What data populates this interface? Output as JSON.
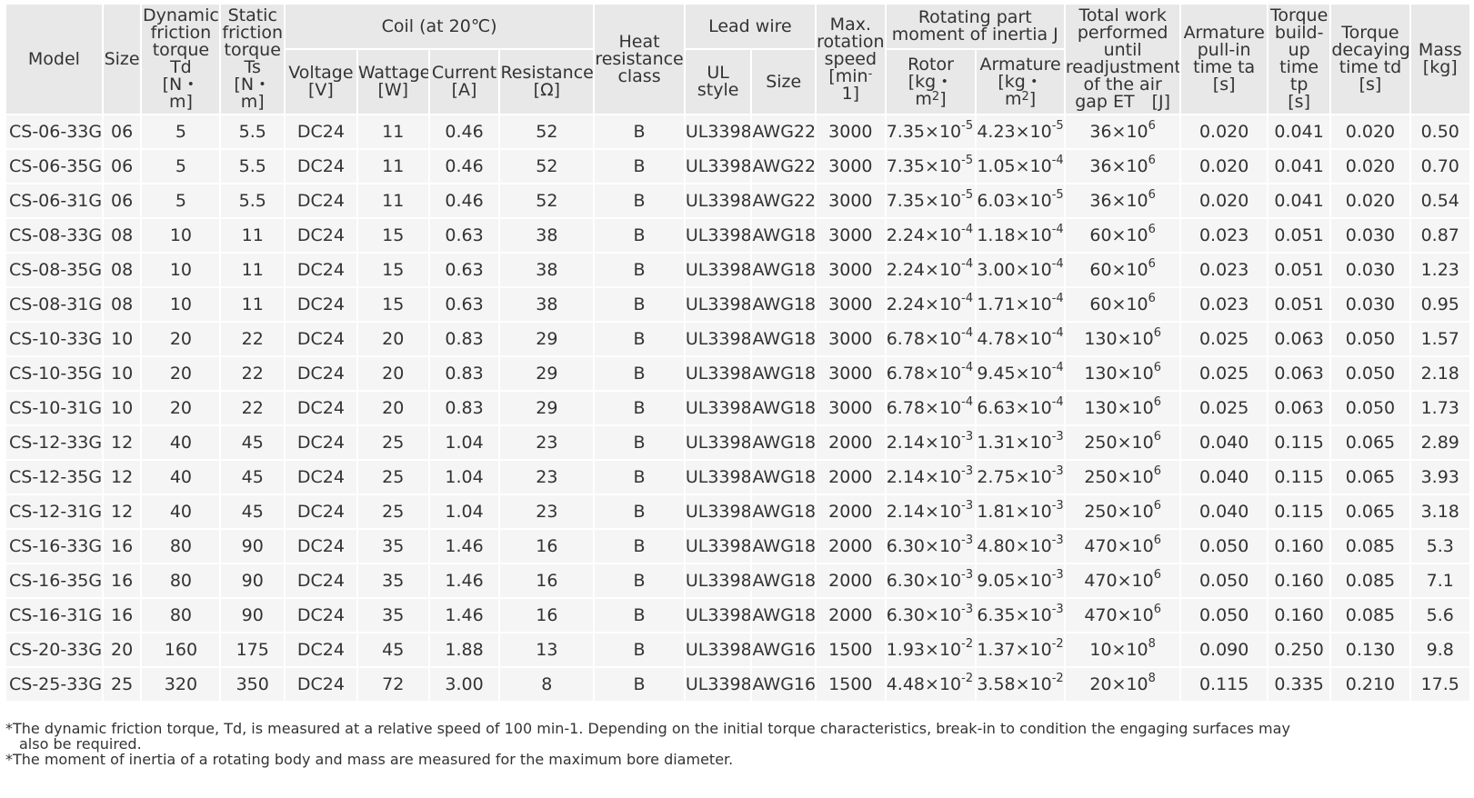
{
  "headers": {
    "model": "Model",
    "size": "Size",
    "dynamic": [
      "Dynamic",
      "friction",
      "torque",
      "Td",
      "[N・",
      "m]"
    ],
    "static": [
      "Static",
      "friction",
      "torque",
      "Ts",
      "[N・",
      "m]"
    ],
    "coil": "Coil (at 20℃)",
    "voltage": [
      "Voltage",
      "[V]"
    ],
    "wattage": [
      "Wattage",
      "[W]"
    ],
    "current": [
      "Current",
      "[A]"
    ],
    "resistance": [
      "Resistance",
      "[Ω]"
    ],
    "heat": [
      "Heat",
      "resistance",
      "class"
    ],
    "lead_wire": "Lead wire",
    "ul_style": [
      "UL",
      "style"
    ],
    "lead_size": "Size",
    "max_speed": [
      "Max.",
      "rotation",
      "speed",
      "[min",
      "-",
      "1]"
    ],
    "inertia": [
      "Rotating part",
      "moment of inertia J"
    ],
    "rotor": [
      "Rotor",
      "[kg・",
      "m",
      "2",
      "]"
    ],
    "armature": [
      "Armature",
      "[kg・",
      "m",
      "2",
      "]"
    ],
    "total_work": [
      "Total work",
      "performed",
      "until",
      "readjustment",
      "of the air",
      "gap ET　[J]"
    ],
    "pullin": [
      "Armature",
      "pull-in",
      "time ta",
      "[s]"
    ],
    "buildup": [
      "Torque",
      "build-",
      "up",
      "time",
      "tp",
      "[s]"
    ],
    "decay": [
      "Torque",
      "decaying",
      "time td",
      "[s]"
    ],
    "mass": [
      "Mass",
      "[kg]"
    ]
  },
  "rows": [
    {
      "model": "CS-06-33G",
      "size": "06",
      "td": "5",
      "ts": "5.5",
      "volt": "DC24",
      "watt": "11",
      "current": "0.46",
      "res": "52",
      "heat": "B",
      "ul": "UL3398",
      "wire": "AWG22",
      "speed": "3000",
      "rotor_m": "7.35×10",
      "rotor_e": "-5",
      "arm_m": "4.23×10",
      "arm_e": "-5",
      "work_m": "36×10",
      "work_e": "6",
      "ta": "0.020",
      "tp": "0.041",
      "tdd": "0.020",
      "mass": "0.50"
    },
    {
      "model": "CS-06-35G",
      "size": "06",
      "td": "5",
      "ts": "5.5",
      "volt": "DC24",
      "watt": "11",
      "current": "0.46",
      "res": "52",
      "heat": "B",
      "ul": "UL3398",
      "wire": "AWG22",
      "speed": "3000",
      "rotor_m": "7.35×10",
      "rotor_e": "-5",
      "arm_m": "1.05×10",
      "arm_e": "-4",
      "work_m": "36×10",
      "work_e": "6",
      "ta": "0.020",
      "tp": "0.041",
      "tdd": "0.020",
      "mass": "0.70"
    },
    {
      "model": "CS-06-31G",
      "size": "06",
      "td": "5",
      "ts": "5.5",
      "volt": "DC24",
      "watt": "11",
      "current": "0.46",
      "res": "52",
      "heat": "B",
      "ul": "UL3398",
      "wire": "AWG22",
      "speed": "3000",
      "rotor_m": "7.35×10",
      "rotor_e": "-5",
      "arm_m": "6.03×10",
      "arm_e": "-5",
      "work_m": "36×10",
      "work_e": "6",
      "ta": "0.020",
      "tp": "0.041",
      "tdd": "0.020",
      "mass": "0.54"
    },
    {
      "model": "CS-08-33G",
      "size": "08",
      "td": "10",
      "ts": "11",
      "volt": "DC24",
      "watt": "15",
      "current": "0.63",
      "res": "38",
      "heat": "B",
      "ul": "UL3398",
      "wire": "AWG18",
      "speed": "3000",
      "rotor_m": "2.24×10",
      "rotor_e": "-4",
      "arm_m": "1.18×10",
      "arm_e": "-4",
      "work_m": "60×10",
      "work_e": "6",
      "ta": "0.023",
      "tp": "0.051",
      "tdd": "0.030",
      "mass": "0.87"
    },
    {
      "model": "CS-08-35G",
      "size": "08",
      "td": "10",
      "ts": "11",
      "volt": "DC24",
      "watt": "15",
      "current": "0.63",
      "res": "38",
      "heat": "B",
      "ul": "UL3398",
      "wire": "AWG18",
      "speed": "3000",
      "rotor_m": "2.24×10",
      "rotor_e": "-4",
      "arm_m": "3.00×10",
      "arm_e": "-4",
      "work_m": "60×10",
      "work_e": "6",
      "ta": "0.023",
      "tp": "0.051",
      "tdd": "0.030",
      "mass": "1.23"
    },
    {
      "model": "CS-08-31G",
      "size": "08",
      "td": "10",
      "ts": "11",
      "volt": "DC24",
      "watt": "15",
      "current": "0.63",
      "res": "38",
      "heat": "B",
      "ul": "UL3398",
      "wire": "AWG18",
      "speed": "3000",
      "rotor_m": "2.24×10",
      "rotor_e": "-4",
      "arm_m": "1.71×10",
      "arm_e": "-4",
      "work_m": "60×10",
      "work_e": "6",
      "ta": "0.023",
      "tp": "0.051",
      "tdd": "0.030",
      "mass": "0.95"
    },
    {
      "model": "CS-10-33G",
      "size": "10",
      "td": "20",
      "ts": "22",
      "volt": "DC24",
      "watt": "20",
      "current": "0.83",
      "res": "29",
      "heat": "B",
      "ul": "UL3398",
      "wire": "AWG18",
      "speed": "3000",
      "rotor_m": "6.78×10",
      "rotor_e": "-4",
      "arm_m": "4.78×10",
      "arm_e": "-4",
      "work_m": "130×10",
      "work_e": "6",
      "ta": "0.025",
      "tp": "0.063",
      "tdd": "0.050",
      "mass": "1.57"
    },
    {
      "model": "CS-10-35G",
      "size": "10",
      "td": "20",
      "ts": "22",
      "volt": "DC24",
      "watt": "20",
      "current": "0.83",
      "res": "29",
      "heat": "B",
      "ul": "UL3398",
      "wire": "AWG18",
      "speed": "3000",
      "rotor_m": "6.78×10",
      "rotor_e": "-4",
      "arm_m": "9.45×10",
      "arm_e": "-4",
      "work_m": "130×10",
      "work_e": "6",
      "ta": "0.025",
      "tp": "0.063",
      "tdd": "0.050",
      "mass": "2.18"
    },
    {
      "model": "CS-10-31G",
      "size": "10",
      "td": "20",
      "ts": "22",
      "volt": "DC24",
      "watt": "20",
      "current": "0.83",
      "res": "29",
      "heat": "B",
      "ul": "UL3398",
      "wire": "AWG18",
      "speed": "3000",
      "rotor_m": "6.78×10",
      "rotor_e": "-4",
      "arm_m": "6.63×10",
      "arm_e": "-4",
      "work_m": "130×10",
      "work_e": "6",
      "ta": "0.025",
      "tp": "0.063",
      "tdd": "0.050",
      "mass": "1.73"
    },
    {
      "model": "CS-12-33G",
      "size": "12",
      "td": "40",
      "ts": "45",
      "volt": "DC24",
      "watt": "25",
      "current": "1.04",
      "res": "23",
      "heat": "B",
      "ul": "UL3398",
      "wire": "AWG18",
      "speed": "2000",
      "rotor_m": "2.14×10",
      "rotor_e": "-3",
      "arm_m": "1.31×10",
      "arm_e": "-3",
      "work_m": "250×10",
      "work_e": "6",
      "ta": "0.040",
      "tp": "0.115",
      "tdd": "0.065",
      "mass": "2.89"
    },
    {
      "model": "CS-12-35G",
      "size": "12",
      "td": "40",
      "ts": "45",
      "volt": "DC24",
      "watt": "25",
      "current": "1.04",
      "res": "23",
      "heat": "B",
      "ul": "UL3398",
      "wire": "AWG18",
      "speed": "2000",
      "rotor_m": "2.14×10",
      "rotor_e": "-3",
      "arm_m": "2.75×10",
      "arm_e": "-3",
      "work_m": "250×10",
      "work_e": "6",
      "ta": "0.040",
      "tp": "0.115",
      "tdd": "0.065",
      "mass": "3.93"
    },
    {
      "model": "CS-12-31G",
      "size": "12",
      "td": "40",
      "ts": "45",
      "volt": "DC24",
      "watt": "25",
      "current": "1.04",
      "res": "23",
      "heat": "B",
      "ul": "UL3398",
      "wire": "AWG18",
      "speed": "2000",
      "rotor_m": "2.14×10",
      "rotor_e": "-3",
      "arm_m": "1.81×10",
      "arm_e": "-3",
      "work_m": "250×10",
      "work_e": "6",
      "ta": "0.040",
      "tp": "0.115",
      "tdd": "0.065",
      "mass": "3.18"
    },
    {
      "model": "CS-16-33G",
      "size": "16",
      "td": "80",
      "ts": "90",
      "volt": "DC24",
      "watt": "35",
      "current": "1.46",
      "res": "16",
      "heat": "B",
      "ul": "UL3398",
      "wire": "AWG18",
      "speed": "2000",
      "rotor_m": "6.30×10",
      "rotor_e": "-3",
      "arm_m": "4.80×10",
      "arm_e": "-3",
      "work_m": "470×10",
      "work_e": "6",
      "ta": "0.050",
      "tp": "0.160",
      "tdd": "0.085",
      "mass": "5.3"
    },
    {
      "model": "CS-16-35G",
      "size": "16",
      "td": "80",
      "ts": "90",
      "volt": "DC24",
      "watt": "35",
      "current": "1.46",
      "res": "16",
      "heat": "B",
      "ul": "UL3398",
      "wire": "AWG18",
      "speed": "2000",
      "rotor_m": "6.30×10",
      "rotor_e": "-3",
      "arm_m": "9.05×10",
      "arm_e": "-3",
      "work_m": "470×10",
      "work_e": "6",
      "ta": "0.050",
      "tp": "0.160",
      "tdd": "0.085",
      "mass": "7.1"
    },
    {
      "model": "CS-16-31G",
      "size": "16",
      "td": "80",
      "ts": "90",
      "volt": "DC24",
      "watt": "35",
      "current": "1.46",
      "res": "16",
      "heat": "B",
      "ul": "UL3398",
      "wire": "AWG18",
      "speed": "2000",
      "rotor_m": "6.30×10",
      "rotor_e": "-3",
      "arm_m": "6.35×10",
      "arm_e": "-3",
      "work_m": "470×10",
      "work_e": "6",
      "ta": "0.050",
      "tp": "0.160",
      "tdd": "0.085",
      "mass": "5.6"
    },
    {
      "model": "CS-20-33G",
      "size": "20",
      "td": "160",
      "ts": "175",
      "volt": "DC24",
      "watt": "45",
      "current": "1.88",
      "res": "13",
      "heat": "B",
      "ul": "UL3398",
      "wire": "AWG16",
      "speed": "1500",
      "rotor_m": "1.93×10",
      "rotor_e": "-2",
      "arm_m": "1.37×10",
      "arm_e": "-2",
      "work_m": "10×10",
      "work_e": "8",
      "ta": "0.090",
      "tp": "0.250",
      "tdd": "0.130",
      "mass": "9.8"
    },
    {
      "model": "CS-25-33G",
      "size": "25",
      "td": "320",
      "ts": "350",
      "volt": "DC24",
      "watt": "72",
      "current": "3.00",
      "res": "8",
      "heat": "B",
      "ul": "UL3398",
      "wire": "AWG16",
      "speed": "1500",
      "rotor_m": "4.48×10",
      "rotor_e": "-2",
      "arm_m": "3.58×10",
      "arm_e": "-2",
      "work_m": "20×10",
      "work_e": "8",
      "ta": "0.115",
      "tp": "0.335",
      "tdd": "0.210",
      "mass": "17.5"
    }
  ],
  "notes": {
    "note1_line1": "*The dynamic friction torque, Td, is measured at a relative speed of 100 min-1. Depending on the initial torque characteristics, break-in to condition the engaging surfaces may",
    "note1_line2": "also be required.",
    "note2": "*The moment of inertia of a rotating body and mass are measured for the maximum bore diameter."
  }
}
